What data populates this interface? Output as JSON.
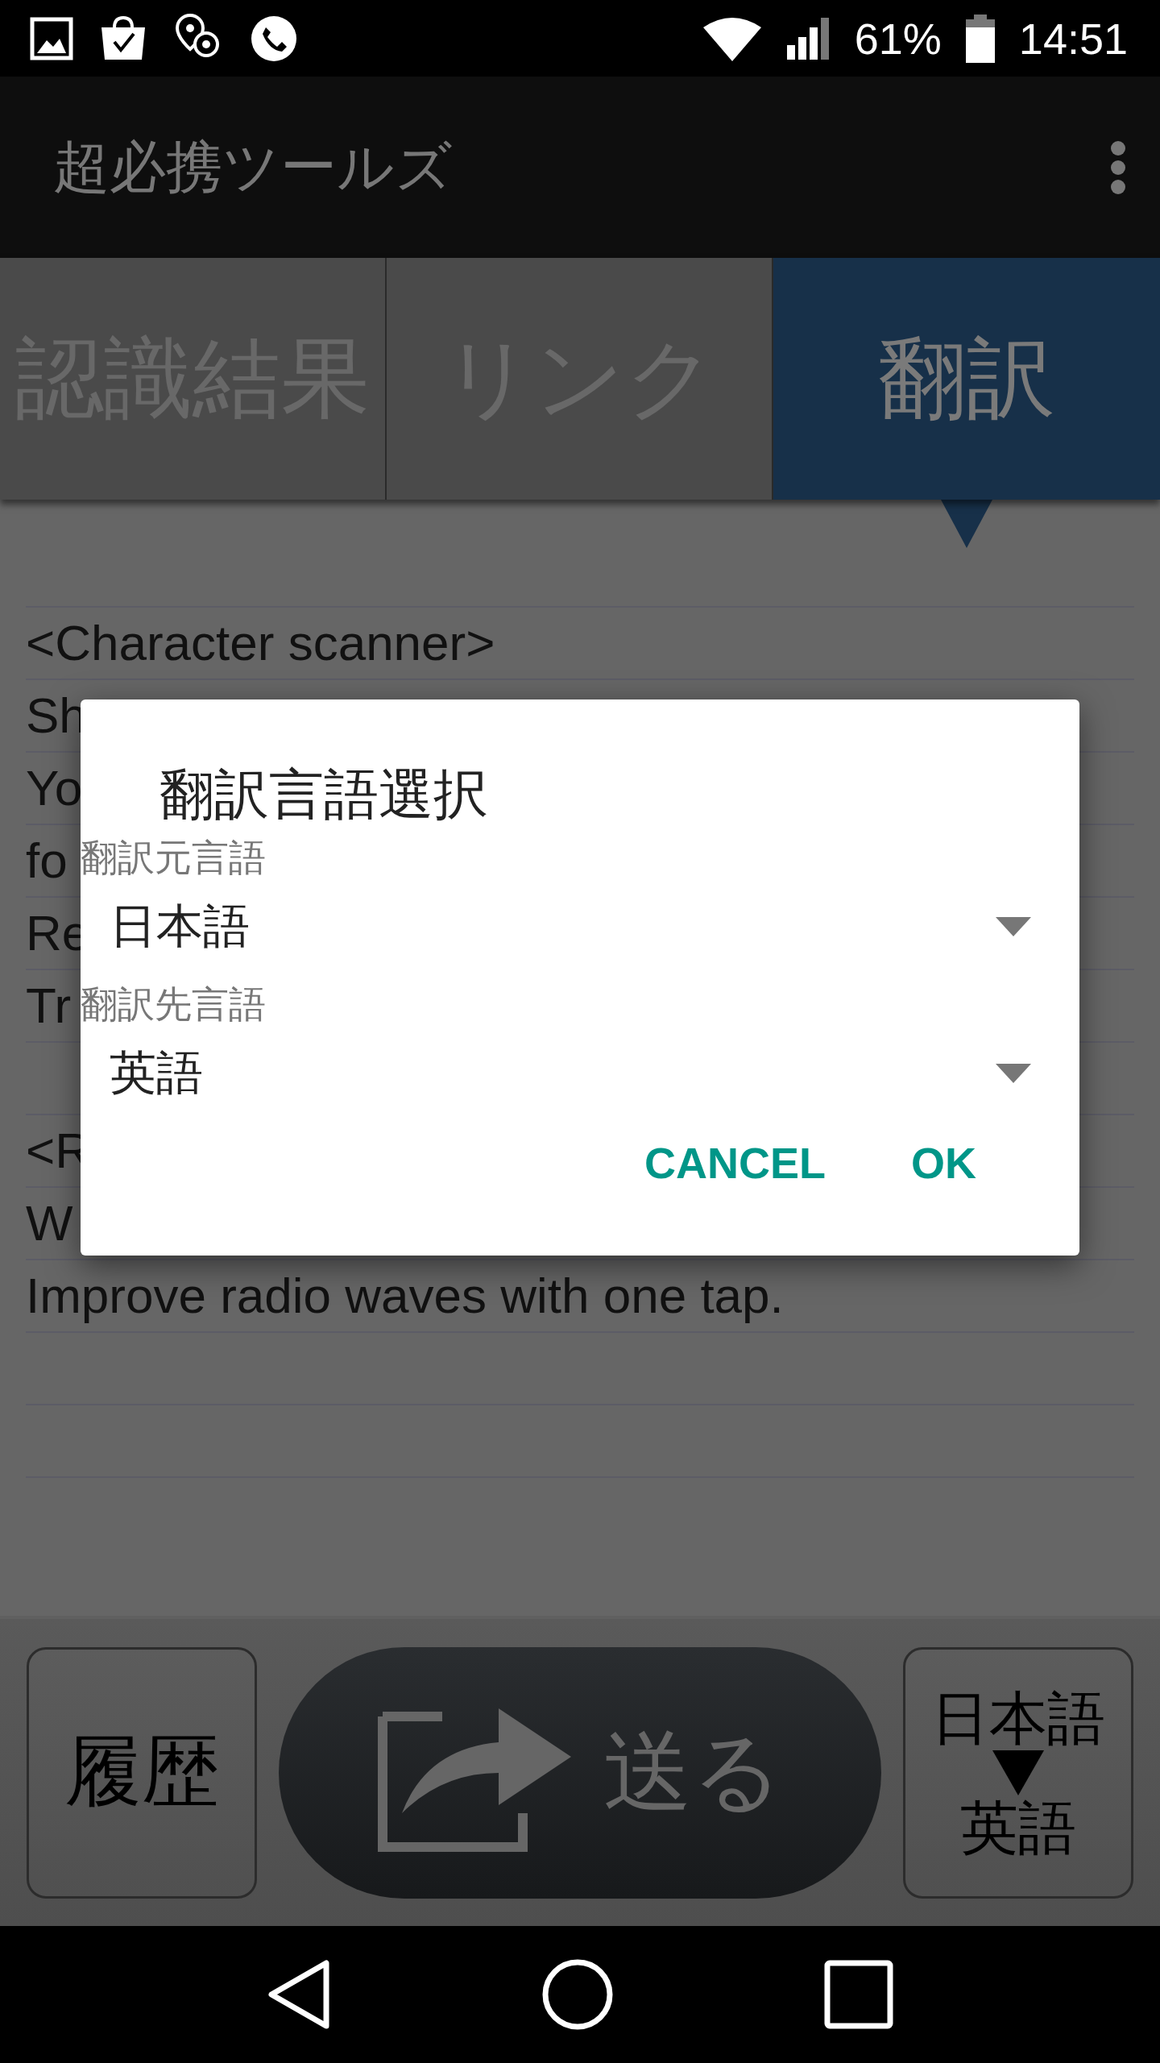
{
  "status_bar": {
    "battery": "61%",
    "time": "14:51"
  },
  "app_bar": {
    "title": "超必携ツールズ"
  },
  "tabs": [
    {
      "label": "認識結果",
      "selected": false
    },
    {
      "label": "リンク",
      "selected": false
    },
    {
      "label": "翻訳",
      "selected": true
    }
  ],
  "content": {
    "paragraphs": [
      [
        "<Character scanner>",
        "Sh",
        "Yo",
        "fo",
        "Re",
        "Tr"
      ],
      [
        "<R",
        "W",
        "Improve radio waves with one tap."
      ]
    ]
  },
  "dialog": {
    "title": "翻訳言語選択",
    "fields": [
      {
        "label": "翻訳元言語",
        "value": "日本語"
      },
      {
        "label": "翻訳先言語",
        "value": "英語"
      }
    ],
    "buttons": [
      "CANCEL",
      "OK"
    ]
  },
  "bottom_bar": {
    "history_button": "履歴",
    "send_button": "送る",
    "language_button": {
      "source": "日本語",
      "target": "英語"
    }
  }
}
